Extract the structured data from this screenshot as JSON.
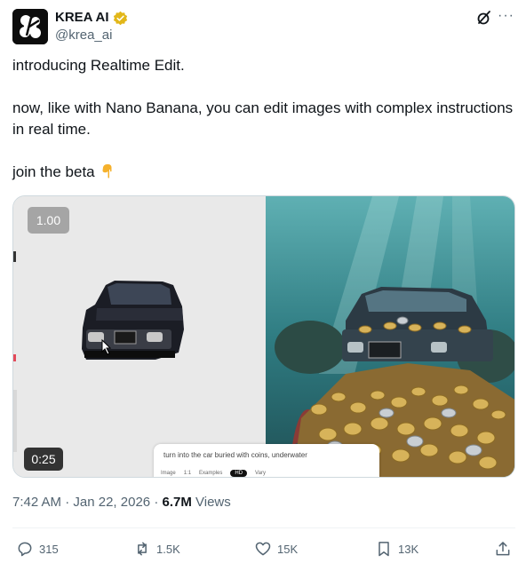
{
  "author": {
    "name": "KREA AI",
    "handle": "@krea_ai",
    "verified_color": "#e2b719",
    "avatar_icon": "krea-logo-icon"
  },
  "header_actions": {
    "grok_icon": "grok-icon",
    "more_label": "···"
  },
  "tweet": {
    "line1": "introducing Realtime Edit.",
    "line2": "now, like with Nano Banana, you can edit images with complex instructions in real time.",
    "line3": "join the beta",
    "line3_emoji": "pointing-down-emoji"
  },
  "media": {
    "speed": "1.00",
    "duration": "0:25",
    "prompt": "turn into the car buried with coins, underwater",
    "prompt_tools": [
      "Image",
      "1:1",
      "Examples",
      "HD",
      "Vary"
    ]
  },
  "meta": {
    "time": "7:42 AM",
    "separator": "·",
    "date": "Jan 22, 2026",
    "views_count": "6.7M",
    "views_label": "Views"
  },
  "actions": {
    "replies": "315",
    "reposts": "1.5K",
    "likes": "15K",
    "bookmarks": "13K"
  },
  "colors": {
    "text": "#0f1419",
    "secondary": "#536471",
    "border": "#cfd9de"
  }
}
